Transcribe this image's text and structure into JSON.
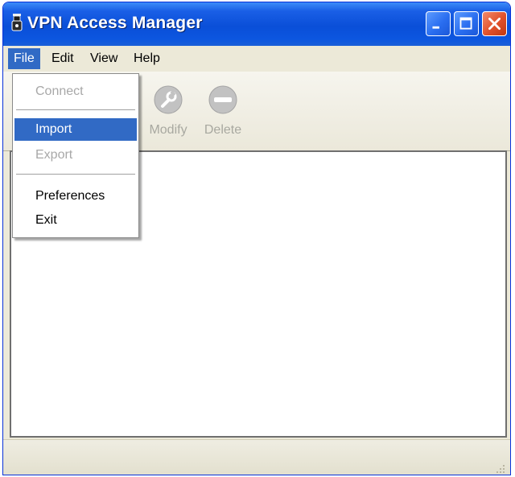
{
  "window": {
    "title": "VPN Access Manager",
    "titlebar_buttons": [
      "minimize-icon",
      "maximize-icon",
      "close-icon"
    ]
  },
  "menubar": {
    "items": [
      "File",
      "Edit",
      "View",
      "Help"
    ],
    "active": "File"
  },
  "toolbar": {
    "buttons": [
      {
        "label": "Modify",
        "icon": "wrench-icon",
        "enabled": false
      },
      {
        "label": "Delete",
        "icon": "minus-circle-icon",
        "enabled": false
      }
    ]
  },
  "file_menu": {
    "items": [
      {
        "label": "Connect",
        "enabled": false
      },
      {
        "label": "Import",
        "enabled": true,
        "highlighted": true
      },
      {
        "label": "Export",
        "enabled": false
      },
      {
        "label": "Preferences",
        "enabled": true
      },
      {
        "label": "Exit",
        "enabled": true
      }
    ]
  },
  "colors": {
    "titlebar": "#0a4fd8",
    "selection": "#316ac5",
    "chrome": "#ece9d8"
  }
}
